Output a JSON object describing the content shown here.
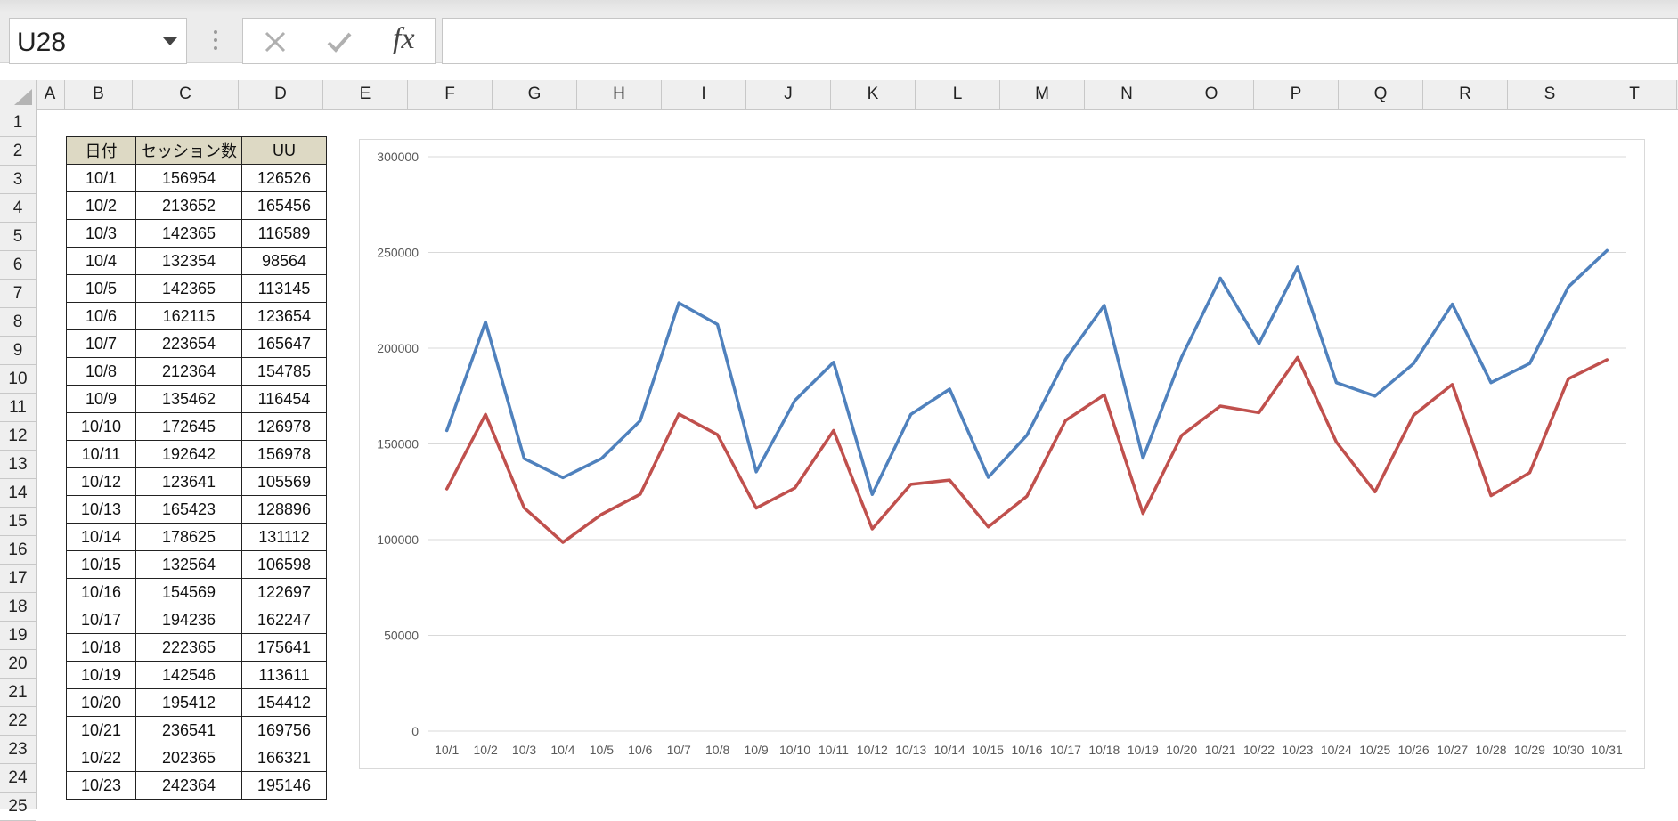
{
  "formula_bar": {
    "name_box": "U28",
    "fx_label": "fx",
    "formula": ""
  },
  "columns": [
    "A",
    "B",
    "C",
    "D",
    "E",
    "F",
    "G",
    "H",
    "I",
    "J",
    "K",
    "L",
    "M",
    "N",
    "O",
    "P",
    "Q",
    "R",
    "S",
    "T"
  ],
  "rows": [
    "1",
    "2",
    "3",
    "4",
    "5",
    "6",
    "7",
    "8",
    "9",
    "10",
    "11",
    "12",
    "13",
    "14",
    "15",
    "16",
    "17",
    "18",
    "19",
    "20",
    "21",
    "22",
    "23",
    "24",
    "25"
  ],
  "table": {
    "headers": [
      "日付",
      "セッション数",
      "UU"
    ],
    "rows": [
      [
        "10/1",
        "156954",
        "126526"
      ],
      [
        "10/2",
        "213652",
        "165456"
      ],
      [
        "10/3",
        "142365",
        "116589"
      ],
      [
        "10/4",
        "132354",
        "98564"
      ],
      [
        "10/5",
        "142365",
        "113145"
      ],
      [
        "10/6",
        "162115",
        "123654"
      ],
      [
        "10/7",
        "223654",
        "165647"
      ],
      [
        "10/8",
        "212364",
        "154785"
      ],
      [
        "10/9",
        "135462",
        "116454"
      ],
      [
        "10/10",
        "172645",
        "126978"
      ],
      [
        "10/11",
        "192642",
        "156978"
      ],
      [
        "10/12",
        "123641",
        "105569"
      ],
      [
        "10/13",
        "165423",
        "128896"
      ],
      [
        "10/14",
        "178625",
        "131112"
      ],
      [
        "10/15",
        "132564",
        "106598"
      ],
      [
        "10/16",
        "154569",
        "122697"
      ],
      [
        "10/17",
        "194236",
        "162247"
      ],
      [
        "10/18",
        "222365",
        "175641"
      ],
      [
        "10/19",
        "142546",
        "113611"
      ],
      [
        "10/20",
        "195412",
        "154412"
      ],
      [
        "10/21",
        "236541",
        "169756"
      ],
      [
        "10/22",
        "202365",
        "166321"
      ],
      [
        "10/23",
        "242364",
        "195146"
      ]
    ]
  },
  "chart_data": {
    "type": "line",
    "title": "",
    "xlabel": "",
    "ylabel": "",
    "ylim": [
      0,
      300000
    ],
    "yticks": [
      0,
      50000,
      100000,
      150000,
      200000,
      250000,
      300000
    ],
    "grid": true,
    "legend": "none",
    "categories": [
      "10/1",
      "10/2",
      "10/3",
      "10/4",
      "10/5",
      "10/6",
      "10/7",
      "10/8",
      "10/9",
      "10/10",
      "10/11",
      "10/12",
      "10/13",
      "10/14",
      "10/15",
      "10/16",
      "10/17",
      "10/18",
      "10/19",
      "10/20",
      "10/21",
      "10/22",
      "10/23",
      "10/24",
      "10/25",
      "10/26",
      "10/27",
      "10/28",
      "10/29",
      "10/30",
      "10/31"
    ],
    "series": [
      {
        "color": "#4f81bd",
        "values": [
          156954,
          213652,
          142365,
          132354,
          142365,
          162115,
          223654,
          212364,
          135462,
          172645,
          192642,
          123641,
          165423,
          178625,
          132564,
          154569,
          194236,
          222365,
          142546,
          195412,
          236541,
          202365,
          242364,
          182000,
          175000,
          192000,
          223000,
          182000,
          192000,
          232000,
          251000
        ]
      },
      {
        "color": "#c0504d",
        "values": [
          126526,
          165456,
          116589,
          98564,
          113145,
          123654,
          165647,
          154785,
          116454,
          126978,
          156978,
          105569,
          128896,
          131112,
          106598,
          122697,
          162247,
          175641,
          113611,
          154412,
          169756,
          166321,
          195146,
          151000,
          125000,
          165000,
          181000,
          123000,
          135000,
          184000,
          194000
        ]
      }
    ]
  }
}
